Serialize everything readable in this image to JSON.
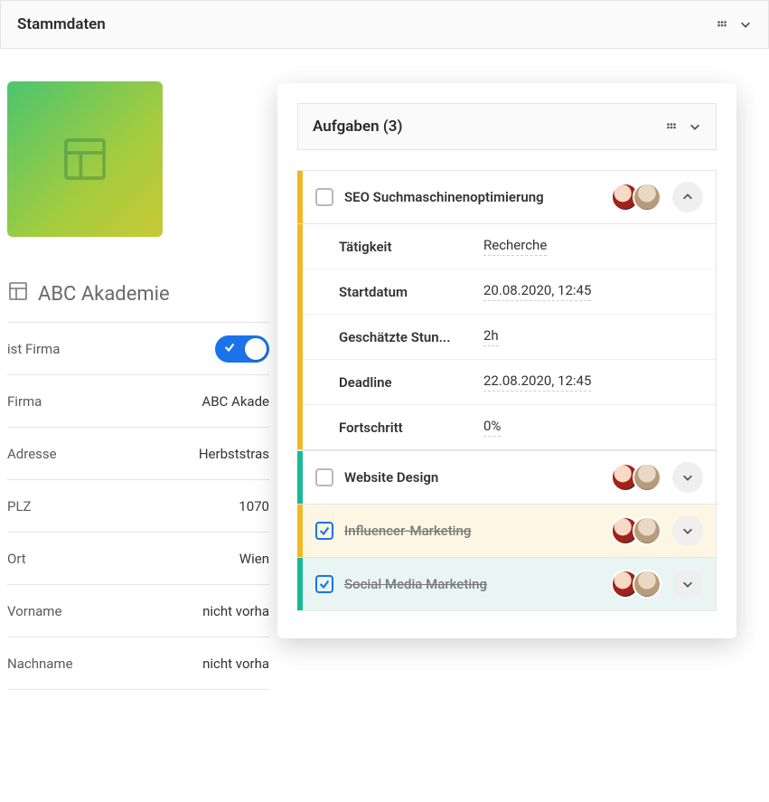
{
  "header": {
    "title": "Stammdaten"
  },
  "company": {
    "name": "ABC Akademie",
    "fields": [
      {
        "label": "ist Firma",
        "type": "toggle",
        "on": true
      },
      {
        "label": "Firma",
        "value": "ABC Akade"
      },
      {
        "label": "Adresse",
        "value": "Herbststras"
      },
      {
        "label": "PLZ",
        "value": "1070"
      },
      {
        "label": "Ort",
        "value": "Wien"
      },
      {
        "label": "Vorname",
        "value": "nicht vorha"
      },
      {
        "label": "Nachname",
        "value": "nicht vorha"
      }
    ]
  },
  "tasks": {
    "title": "Aufgaben (3)",
    "items": [
      {
        "title": "SEO Suchmaschinenoptimierung",
        "checked": false,
        "stripe": "orange",
        "expanded": true,
        "details": {
          "taetigkeit_label": "Tätigkeit",
          "taetigkeit": "Recherche",
          "start_label": "Startdatum",
          "start": "20.08.2020, 12:45",
          "est_label": "Geschätzte Stun...",
          "est": "2h",
          "deadline_label": "Deadline",
          "deadline": "22.08.2020, 12:45",
          "progress_label": "Fortschritt",
          "progress": "0%"
        }
      },
      {
        "title": "Website Design",
        "checked": false,
        "stripe": "teal"
      },
      {
        "title": "Influencer-Marketing",
        "checked": true,
        "stripe": "orange",
        "bg": "cream"
      },
      {
        "title": "Social Media Marketing",
        "checked": true,
        "stripe": "teal",
        "bg": "mint"
      }
    ]
  }
}
